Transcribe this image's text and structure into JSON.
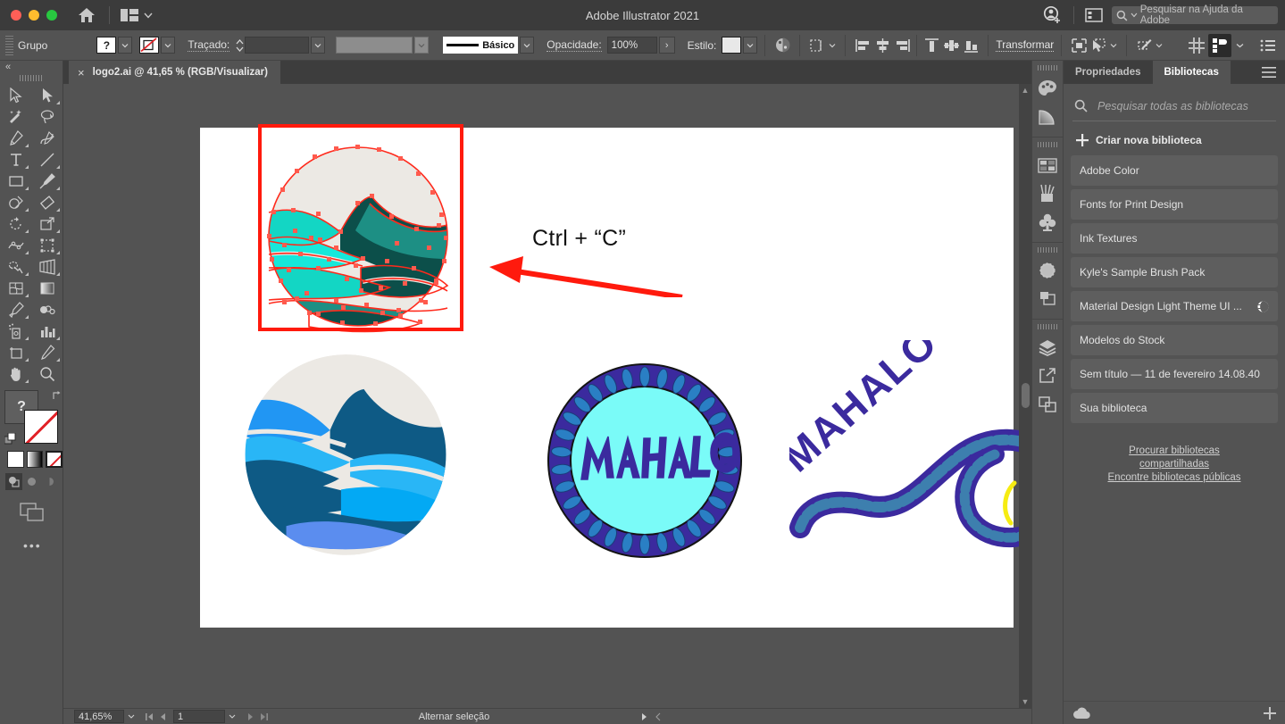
{
  "window": {
    "title": "Adobe Illustrator 2021",
    "traffic_lights": [
      "close",
      "minimize",
      "maximize"
    ],
    "home_icon": "home-icon",
    "arrange_icon": "arrange-documents-icon",
    "account_icon": "account-add-icon",
    "screen_icon": "screen-mode-icon",
    "help_search_placeholder": "Pesquisar na Ajuda da Adobe"
  },
  "control_bar": {
    "selection_label": "Grupo",
    "fill_swatch_text": "?",
    "stroke_swatch_icon": "none-swatch-icon",
    "stroke_label": "Traçado:",
    "stroke_weight_value": "",
    "stroke_profile_value": "",
    "brush_definition_label": "Básico",
    "opacity_label": "Opacidade:",
    "opacity_value": "100%",
    "opacity_more": "›",
    "style_label": "Estilo:",
    "icons": {
      "recolor": "recolor-artwork-icon",
      "arrange": "arrange-objects-icon",
      "align_left": "align-left-icon",
      "align_center_h": "align-center-horizontal-icon",
      "align_right": "align-right-icon",
      "align_top": "align-top-icon",
      "align_center_v": "align-center-vertical-icon",
      "align_bottom": "align-bottom-icon",
      "isolate": "isolate-selection-icon",
      "select_similar": "select-similar-icon",
      "edit_shape": "edit-shape-icon",
      "distribute_spacing": "distribute-spacing-icon",
      "properties_panel": "properties-panel-icon",
      "list_view": "list-view-icon"
    },
    "transform_label": "Transformar"
  },
  "toolbar": {
    "collapse_label": "«",
    "tools": [
      {
        "name": "selection-tool",
        "icon": "cursor-arrow-outline"
      },
      {
        "name": "direct-selection-tool",
        "icon": "cursor-arrow-filled"
      },
      {
        "name": "magic-wand-tool",
        "icon": "magic-wand"
      },
      {
        "name": "lasso-tool",
        "icon": "lasso"
      },
      {
        "name": "pen-tool",
        "icon": "pen"
      },
      {
        "name": "curvature-tool",
        "icon": "curvature"
      },
      {
        "name": "type-tool",
        "icon": "type-T"
      },
      {
        "name": "line-segment-tool",
        "icon": "line-diagonal"
      },
      {
        "name": "rectangle-tool",
        "icon": "rectangle"
      },
      {
        "name": "paintbrush-tool",
        "icon": "paintbrush"
      },
      {
        "name": "shaper-tool",
        "icon": "shaper"
      },
      {
        "name": "eraser-tool",
        "icon": "eraser"
      },
      {
        "name": "rotate-tool",
        "icon": "rotate"
      },
      {
        "name": "scale-tool",
        "icon": "scale"
      },
      {
        "name": "width-tool",
        "icon": "width"
      },
      {
        "name": "free-transform-tool",
        "icon": "free-transform"
      },
      {
        "name": "shape-builder-tool",
        "icon": "shape-builder"
      },
      {
        "name": "perspective-grid-tool",
        "icon": "perspective-grid"
      },
      {
        "name": "mesh-tool",
        "icon": "mesh"
      },
      {
        "name": "gradient-tool",
        "icon": "gradient"
      },
      {
        "name": "eyedropper-tool",
        "icon": "eyedropper"
      },
      {
        "name": "blend-tool",
        "icon": "blend"
      },
      {
        "name": "symbol-sprayer-tool",
        "icon": "symbol-sprayer"
      },
      {
        "name": "column-graph-tool",
        "icon": "bar-chart"
      },
      {
        "name": "artboard-tool",
        "icon": "artboard"
      },
      {
        "name": "slice-tool",
        "icon": "slice-knife"
      },
      {
        "name": "hand-tool",
        "icon": "hand"
      },
      {
        "name": "zoom-tool",
        "icon": "magnifier"
      }
    ],
    "fill_label": "?",
    "stroke_none": true,
    "color_modes": [
      "color-swatch-white",
      "gradient-swatch",
      "none-swatch"
    ],
    "draw_modes": [
      "draw-normal",
      "draw-behind",
      "draw-inside"
    ],
    "screen_mode_icon": "screen-mode-icon",
    "more_tools_icon": "more-tools-ellipsis"
  },
  "document": {
    "tab_title": "logo2.ai @ 41,65 % (RGB/Visualizar)",
    "tab_close": "×"
  },
  "canvas": {
    "annotation_text": "Ctrl + “C”",
    "selection_color": "#ff2a1c",
    "artwork": [
      {
        "name": "wave-circle-logo-selected",
        "state": "selected",
        "colors": [
          "#ece9e4",
          "#13d6c4",
          "#1d8f84",
          "#0c4f4a"
        ]
      },
      {
        "name": "wave-circle-logo-blue",
        "state": "normal",
        "colors": [
          "#ece9e4",
          "#2196f3",
          "#0e5a85",
          "#29b6f6",
          "#5b8def"
        ]
      },
      {
        "name": "mahalo-badge-logo",
        "state": "normal",
        "label": "MAHALO",
        "colors": [
          "#3b2a9e",
          "#7afbf8",
          "#2a7fc4"
        ]
      },
      {
        "name": "mahalo-swirl-logo",
        "state": "normal",
        "label": "MAHALO",
        "colors": [
          "#3b2a9e",
          "#3d7fae",
          "#f6ec12"
        ]
      }
    ]
  },
  "status_bar": {
    "zoom_value": "41,65%",
    "page_value": "1",
    "status_text": "Alternar seleção",
    "first_page_icon": "first-page-icon",
    "prev_page_icon": "prev-page-icon",
    "next_page_icon": "next-page-icon",
    "last_page_icon": "last-page-icon",
    "play_icon": "play-icon",
    "chevron_icon": "chevron-left-icon"
  },
  "dock_rail": {
    "groups": [
      [
        "color-panel-icon",
        "color-guide-icon"
      ],
      [
        "swatches-panel-icon",
        "brushes-panel-icon",
        "symbols-panel-icon"
      ],
      [
        "appearance-panel-icon",
        "pathfinder-panel-icon"
      ],
      [
        "layers-panel-icon",
        "export-panel-icon",
        "artboards-panel-icon"
      ]
    ]
  },
  "panel": {
    "tabs": [
      {
        "label": "Propriedades",
        "active": false,
        "name": "tab-propriedades"
      },
      {
        "label": "Bibliotecas",
        "active": true,
        "name": "tab-bibliotecas"
      }
    ],
    "menu_icon": "panel-menu-icon",
    "search_placeholder": "Pesquisar todas as bibliotecas",
    "search_value": "",
    "search_icon": "search-icon",
    "create_library_label": "Criar nova biblioteca",
    "create_library_icon": "plus-icon",
    "libraries": [
      {
        "label": "Adobe Color",
        "shared": false
      },
      {
        "label": "Fonts for Print Design",
        "shared": false
      },
      {
        "label": "Ink Textures",
        "shared": false
      },
      {
        "label": "Kyle's Sample Brush Pack",
        "shared": false
      },
      {
        "label": "Material Design Light Theme UI ...",
        "shared": true,
        "badge_icon": "globe-icon"
      },
      {
        "label": "Modelos do Stock",
        "shared": false
      },
      {
        "label": "Sem título — 11 de fevereiro 14.08.40",
        "shared": false
      },
      {
        "label": "Sua biblioteca",
        "shared": false
      }
    ],
    "footer_links": [
      "Procurar bibliotecas compartilhadas",
      "Encontre bibliotecas públicas"
    ],
    "bottom_cloud_icon": "cloud-icon",
    "bottom_add_icon": "plus-icon"
  },
  "colors": {
    "chrome": "#535353",
    "chrome_dark": "#3b3b3b",
    "accent_red": "#ff2a1c",
    "panel_item": "#5e5e5e"
  }
}
